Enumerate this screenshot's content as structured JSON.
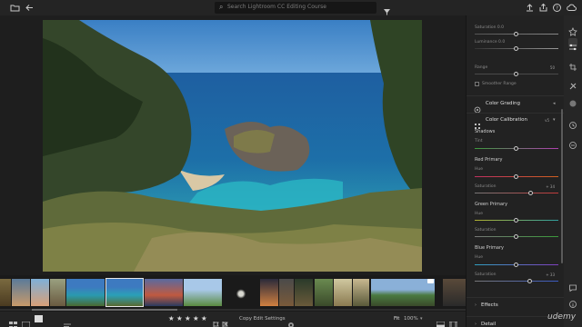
{
  "topbar": {
    "search_placeholder": "Search Lightroom CC Editing Course"
  },
  "panel": {
    "hsl_rows": [
      "Saturation 0.0",
      "Luminance 0.0",
      "Range",
      "Smoother Range"
    ],
    "range_value": "50",
    "color_grading_title": "Color Grading",
    "calibration_title": "Color Calibration",
    "calibration_version": "v5",
    "shadows_label": "Shadows",
    "tint_label": "Tint",
    "red_primary_label": "Red Primary",
    "green_primary_label": "Green Primary",
    "blue_primary_label": "Blue Primary",
    "hue_label": "Hue",
    "saturation_label": "Saturation",
    "red_sat_value": "+ 34",
    "blue_sat_value": "+ 33",
    "effects_title": "Effects",
    "detail_title": "Detail",
    "sliders": {
      "hsl_sat": 0.5,
      "hsl_lum": 0.5,
      "range": 0.5,
      "tint": 0.5,
      "red_hue": 0.5,
      "red_sat": 0.67,
      "green_hue": 0.5,
      "green_sat": 0.5,
      "blue_hue": 0.5,
      "blue_sat": 0.66
    }
  },
  "bottombar": {
    "copy_label": "Copy Edit Settings",
    "fit_label": "Fit",
    "zoom_label": "100%"
  },
  "watermark": "udemy",
  "colors": {
    "accent": "#cfcfcf",
    "panel_bg": "#222222"
  }
}
